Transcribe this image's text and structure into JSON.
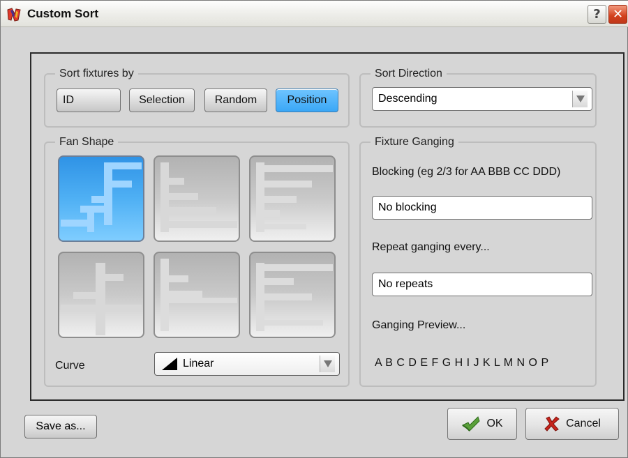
{
  "window": {
    "title": "Custom Sort",
    "help_glyph": "?",
    "close_glyph": "✕"
  },
  "sort_by": {
    "label": "Sort fixtures by",
    "options": [
      {
        "label": "ID",
        "active": false
      },
      {
        "label": "Selection",
        "active": false
      },
      {
        "label": "Random",
        "active": false
      },
      {
        "label": "Position",
        "active": true
      }
    ]
  },
  "sort_direction": {
    "label": "Sort Direction",
    "value": "Descending"
  },
  "fan_shape": {
    "label": "Fan Shape",
    "selected_index": 0,
    "curve_label": "Curve",
    "curve_value": "Linear"
  },
  "ganging": {
    "label": "Fixture Ganging",
    "blocking_label": "Blocking (eg 2/3 for AA BBB CC DDD)",
    "blocking_value": "No blocking",
    "repeat_label": "Repeat ganging every...",
    "repeat_value": "No repeats",
    "preview_label": "Ganging Preview...",
    "preview_value": "A B C D E F G H I J K L M N O P"
  },
  "footer": {
    "save_label": "Save as...",
    "ok_label": "OK",
    "cancel_label": "Cancel"
  },
  "icons": {
    "app": "app-logo-icon",
    "ok": "ok-check-icon",
    "cancel": "cancel-x-icon",
    "dropdown": "chevron-down-icon",
    "curve": "linear-curve-icon"
  },
  "colors": {
    "accent_blue": "#4fb0f4",
    "close_red": "#d2401d"
  }
}
